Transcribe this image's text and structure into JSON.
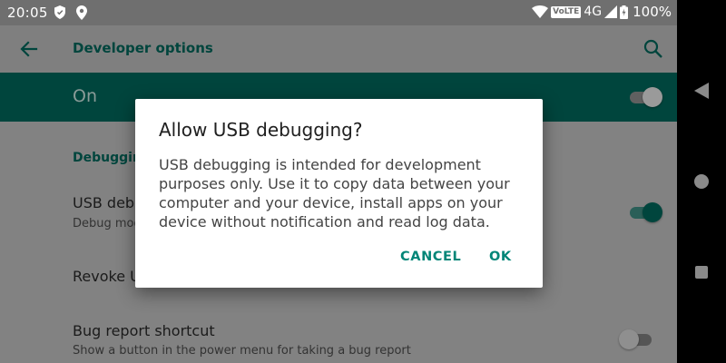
{
  "status_bar": {
    "time": "20:05",
    "volte": "VoLTE",
    "network": "4G",
    "battery": "100%"
  },
  "toolbar": {
    "title": "Developer options",
    "back_icon": "arrow-left-icon",
    "search_icon": "search-icon"
  },
  "master_switch": {
    "label": "On",
    "state": "on"
  },
  "settings": {
    "section_debugging": "Debugging",
    "usb_debugging_title": "USB debugging",
    "usb_debugging_summary": "Debug mode when USB is connected",
    "revoke_title": "Revoke USB debugging authorizations",
    "bug_report_title": "Bug report shortcut",
    "bug_report_summary": "Show a button in the power menu for taking a bug report"
  },
  "dialog": {
    "title": "Allow USB debugging?",
    "message": "USB debugging is intended for development purposes only. Use it to copy data between your computer and your device, install apps on your device without notification and read log data.",
    "cancel_label": "CANCEL",
    "ok_label": "OK"
  },
  "colors": {
    "accent": "#008577",
    "primary_dark": "#00453d"
  }
}
